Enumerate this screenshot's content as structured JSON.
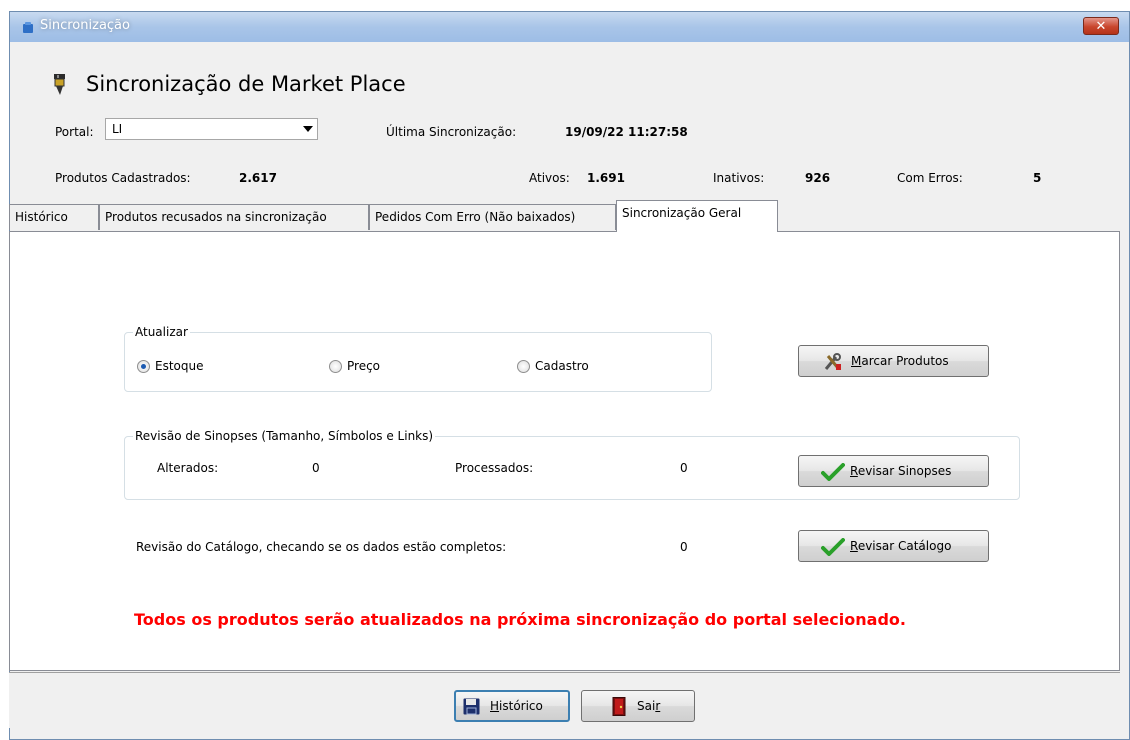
{
  "window": {
    "title": "Sincronização",
    "close_glyph": "✕"
  },
  "header": {
    "title": "Sincronização de Market Place",
    "icon": "pen-icon"
  },
  "portal": {
    "label": "Portal:",
    "value": "LI"
  },
  "last_sync": {
    "label": "Última Sincronização:",
    "value": "19/09/22 11:27:58"
  },
  "stats": {
    "registered_label": "Produtos Cadastrados:",
    "registered_value": "2.617",
    "active_label": "Ativos:",
    "active_value": "1.691",
    "inactive_label": "Inativos:",
    "inactive_value": "926",
    "errors_label": "Com Erros:",
    "errors_value": "5"
  },
  "tabs": [
    {
      "label": "Histórico"
    },
    {
      "label": "Produtos recusados na sincronização"
    },
    {
      "label": "Pedidos Com Erro (Não baixados)"
    },
    {
      "label": "Sincronização Geral",
      "active": true
    }
  ],
  "update_group": {
    "legend": "Atualizar",
    "options": [
      "Estoque",
      "Preço",
      "Cadastro"
    ],
    "selected": "Estoque"
  },
  "mark_button": {
    "accel": "M",
    "rest": "arcar Produtos"
  },
  "synopsis_group": {
    "legend": "Revisão de Sinopses (Tamanho, Símbolos e Links)",
    "changed_label": "Alterados:",
    "changed_value": "0",
    "processed_label": "Processados:",
    "processed_value": "0"
  },
  "review_synopsis_button": {
    "accel": "R",
    "rest": "evisar Sinopses"
  },
  "catalog": {
    "label": "Revisão do Catálogo, checando se os dados estão completos:",
    "value": "0"
  },
  "review_catalog_button": {
    "accel": "R",
    "rest": "evisar Catálogo"
  },
  "warning": "Todos os produtos serão atualizados na próxima sincronização do portal selecionado.",
  "bottom": {
    "history_accel": "H",
    "history_rest": "istórico",
    "exit_pre": "Sai",
    "exit_accel": "r"
  },
  "colors": {
    "titlebar": "#a9c5e8",
    "close": "#c9462d",
    "warning": "#ff0000",
    "check": "#2aa02a"
  }
}
